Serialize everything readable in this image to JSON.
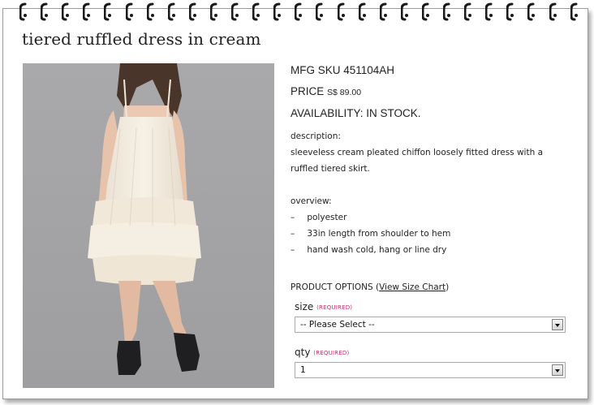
{
  "product": {
    "title": "tiered ruffled dress in cream",
    "sku_label": "MFG SKU 451104AH",
    "price_label": "PRICE",
    "price_value": "S$ 89.00",
    "availability_label": "AVAILABILITY: IN STOCK.",
    "description_heading": "description:",
    "description_text": "sleeveless cream pleated chiffon loosely fitted dress with a ruffled tiered skirt.",
    "overview_heading": "overview:",
    "overview_items": [
      "polyester",
      "33in length from shoulder to hem",
      "hand wash cold, hang or line dry"
    ],
    "bullet_dash": "–"
  },
  "options": {
    "heading": "PRODUCT OPTIONS",
    "size_chart_open": "(",
    "size_chart_link": "View Size Chart",
    "size_chart_close": ")",
    "size_label": "size",
    "size_required": "(REQUIRED)",
    "size_selected": "-- Please Select --",
    "qty_label": "qty",
    "qty_required": "(REQUIRED)",
    "qty_selected": "1"
  },
  "colors": {
    "photo_background": "#a5a5a7",
    "required_text": "#c0306a",
    "text": "#222222"
  },
  "icons": {
    "binding": "spiral-ring-icon",
    "dropdown": "dropdown-arrow-icon"
  }
}
